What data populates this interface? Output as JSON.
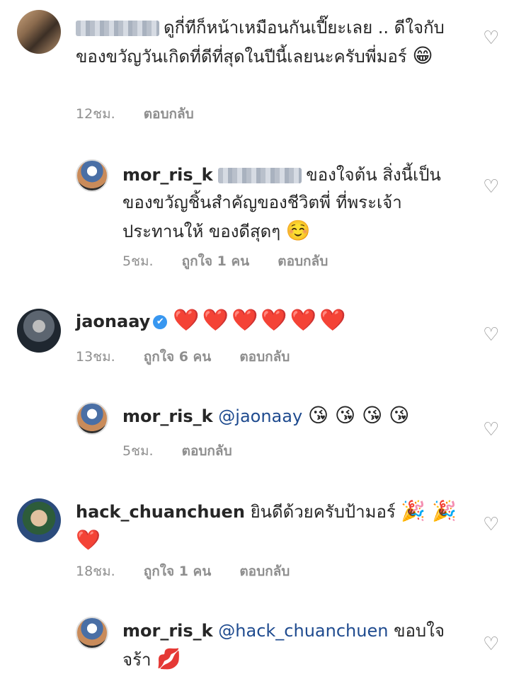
{
  "comments": [
    {
      "username_blurred": true,
      "text": "ดูกี่ทีก็หน้าเหมือนกันเปี๊ยะเลย .. ดีใจกับของขวัญวันเกิดที่ดีที่สุดในปีนี้เลยนะครับพี่มอร์",
      "emoji": "😁",
      "time": "12ชม.",
      "reply": "ตอบกลับ"
    },
    {
      "username": "mor_ris_k",
      "mention_blurred": true,
      "text": "ของใจต้น สิ่งนี้เป็นของขวัญชิ้นสำคัญของชีวิตพี่ ที่พระเจ้าประทานให้ ของดีสุดๆ",
      "emoji": "☺️",
      "time": "5ชม.",
      "likes": "ถูกใจ 1 คน",
      "reply": "ตอบกลับ"
    },
    {
      "username": "jaonaay",
      "verified_icon": "✔",
      "hearts": "❤️❤️❤️❤️❤️❤️",
      "time": "13ชม.",
      "likes": "ถูกใจ 6 คน",
      "reply": "ตอบกลับ"
    },
    {
      "username": "mor_ris_k",
      "mention": "@jaonaay",
      "emoji": "😘 😘 😘 😘",
      "time": "5ชม.",
      "reply": "ตอบกลับ"
    },
    {
      "username": "hack_chuanchuen",
      "text": "ยินดีด้วยครับป้ามอร์",
      "emoji": "🎉 🎉 ❤️",
      "time": "18ชม.",
      "likes": "ถูกใจ 1 คน",
      "reply": "ตอบกลับ"
    },
    {
      "username": "mor_ris_k",
      "mention": "@hack_chuanchuen",
      "text": "ขอบใจจร้า",
      "emoji": "💋"
    }
  ],
  "icons": {
    "like": "♡",
    "like_icon_name": "heart-outline-icon",
    "verified_icon_name": "verified-badge-icon"
  },
  "colors": {
    "text": "#262626",
    "meta": "#8e8e8e",
    "mention": "#1f4b8f",
    "verified": "#3897f0"
  }
}
